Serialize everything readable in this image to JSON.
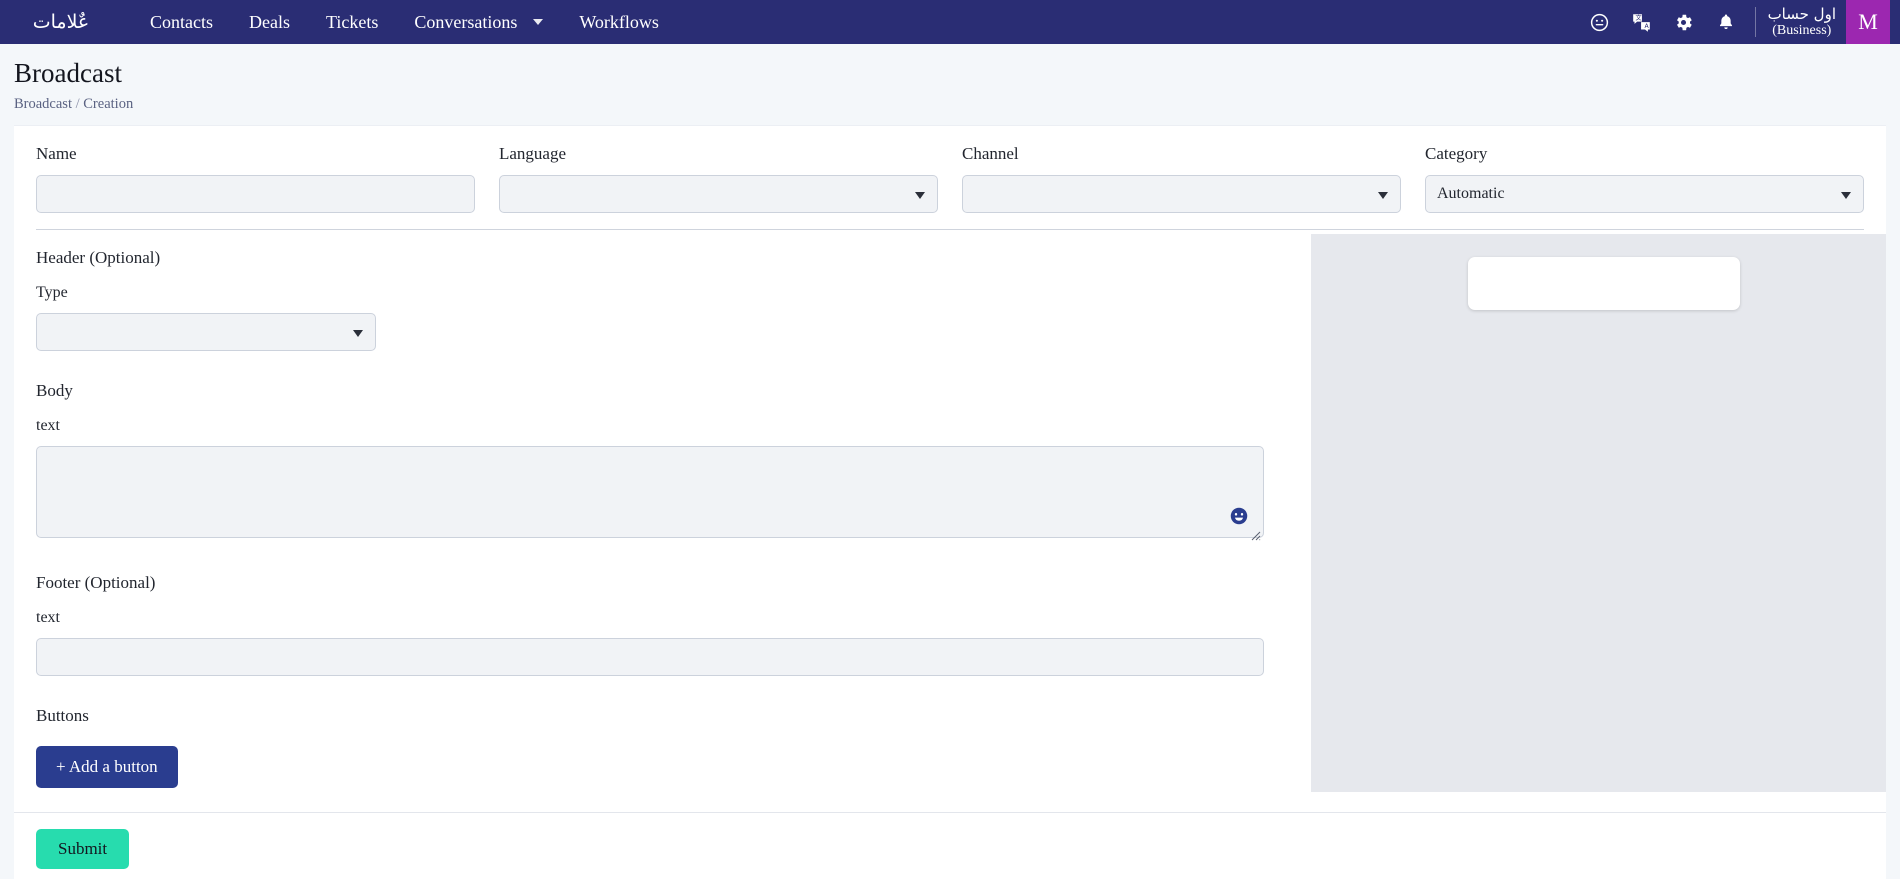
{
  "topnav": {
    "logo_text": "عٌلامات",
    "logo_icon": "brand-logo-arabic",
    "links": [
      {
        "label": "Contacts",
        "has_caret": false
      },
      {
        "label": "Deals",
        "has_caret": false
      },
      {
        "label": "Tickets",
        "has_caret": false
      },
      {
        "label": "Conversations",
        "has_caret": true
      },
      {
        "label": "Workflows",
        "has_caret": false
      }
    ],
    "icons": [
      {
        "name": "help-face-icon"
      },
      {
        "name": "translate-icon"
      },
      {
        "name": "gear-icon"
      },
      {
        "name": "bell-icon"
      }
    ],
    "account": {
      "name": "اول حساب",
      "type": "(Business)",
      "avatar_initial": "M",
      "avatar_color": "#9c27b0"
    }
  },
  "page": {
    "title": "Broadcast",
    "breadcrumb": {
      "root": "Broadcast",
      "separator": "/",
      "current": "Creation"
    }
  },
  "form": {
    "name": {
      "label": "Name",
      "value": "",
      "placeholder": ""
    },
    "language": {
      "label": "Language",
      "value": "",
      "caret": "chevron-down"
    },
    "channel": {
      "label": "Channel",
      "value": "",
      "caret": "chevron-down"
    },
    "category": {
      "label": "Category",
      "value": "Automatic",
      "caret": "chevron-down"
    }
  },
  "header_section": {
    "title": "Header (Optional)",
    "type": {
      "label": "Type",
      "value": ""
    }
  },
  "body_section": {
    "title": "Body",
    "text": {
      "label": "text",
      "value": "",
      "placeholder": ""
    },
    "emoji_icon": "emoji-smiley-icon"
  },
  "footer_section": {
    "title": "Footer (Optional)",
    "text": {
      "label": "text",
      "value": "",
      "placeholder": ""
    }
  },
  "buttons_section": {
    "title": "Buttons",
    "add_button_label": "+ Add a button"
  },
  "preview": {
    "panel_bg": "#e6e8ed",
    "bubble_text": ""
  },
  "actions": {
    "submit_label": "Submit",
    "submit_color": "#27dcae"
  },
  "theme": {
    "nav_bg": "#2a2d74",
    "accent": "#2a3d8f",
    "page_bg": "#f4f7fa"
  }
}
